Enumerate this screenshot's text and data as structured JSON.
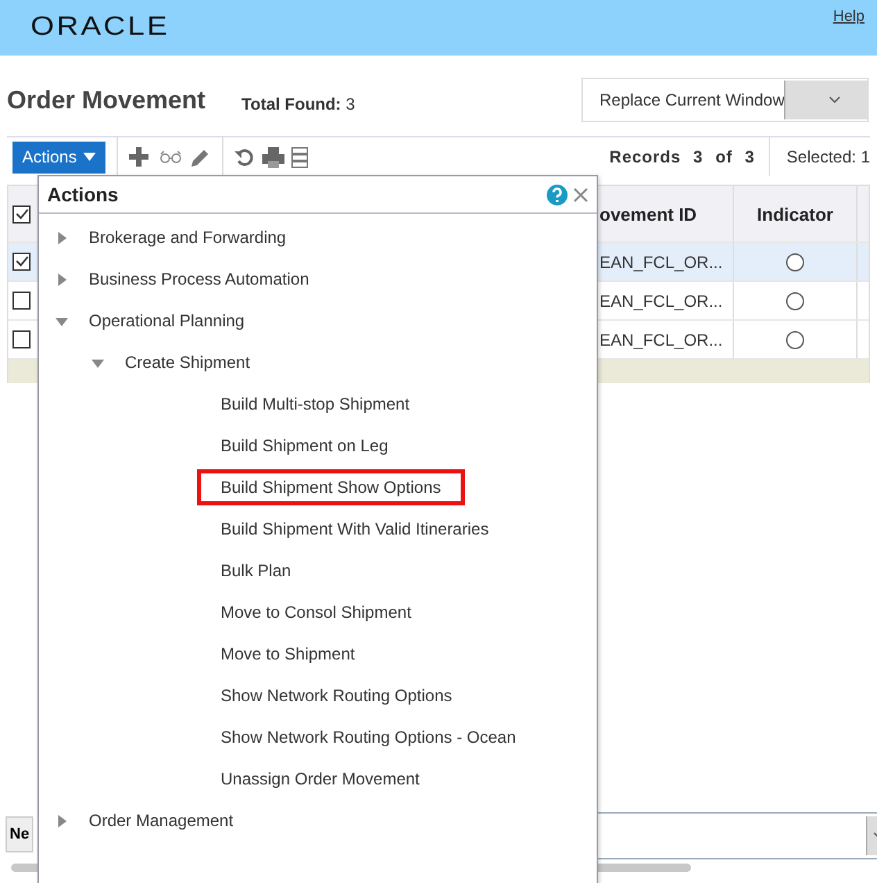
{
  "header": {
    "logo": "ORACLE",
    "help_link": "Help"
  },
  "page": {
    "title": "Order Movement",
    "total_found_label": "Total Found:",
    "total_found": "3",
    "window_select": {
      "value": "Replace Current Window"
    }
  },
  "toolbar": {
    "actions_button": "Actions",
    "records_label": "Records",
    "records_current": "3",
    "records_of": "of",
    "records_total": "3",
    "selected_label": "Selected:",
    "selected_count": "1"
  },
  "table": {
    "select_all_checked": true,
    "columns": [
      "ovement ID",
      "Indicator"
    ],
    "rows": [
      {
        "checked": true,
        "selected": true,
        "movement_id": "EAN_FCL_OR..."
      },
      {
        "checked": false,
        "selected": false,
        "movement_id": "EAN_FCL_OR..."
      },
      {
        "checked": false,
        "selected": false,
        "movement_id": "EAN_FCL_OR..."
      }
    ]
  },
  "actions_popup": {
    "title": "Actions",
    "tree": [
      {
        "label": "Brokerage and Forwarding",
        "expanded": false
      },
      {
        "label": "Business Process Automation",
        "expanded": false
      },
      {
        "label": "Operational Planning",
        "expanded": true,
        "children": [
          {
            "label": "Create Shipment",
            "expanded": true,
            "children": [
              {
                "label": "Build Multi-stop Shipment",
                "selected": false
              },
              {
                "label": "Build Shipment on Leg",
                "selected": false
              },
              {
                "label": "Build Shipment Show Options",
                "selected": true
              },
              {
                "label": "Build Shipment With Valid Itineraries",
                "selected": false
              },
              {
                "label": "Bulk Plan",
                "selected": false
              },
              {
                "label": "Move to Consol Shipment",
                "selected": false
              },
              {
                "label": "Move to Shipment",
                "selected": false
              },
              {
                "label": "Show Network Routing Options",
                "selected": false
              },
              {
                "label": "Show Network Routing Options - Ocean",
                "selected": false
              },
              {
                "label": "Unassign Order Movement",
                "selected": false
              }
            ]
          }
        ]
      },
      {
        "label": "Order Management",
        "expanded": false
      }
    ]
  },
  "footer": {
    "button": "Ne"
  }
}
